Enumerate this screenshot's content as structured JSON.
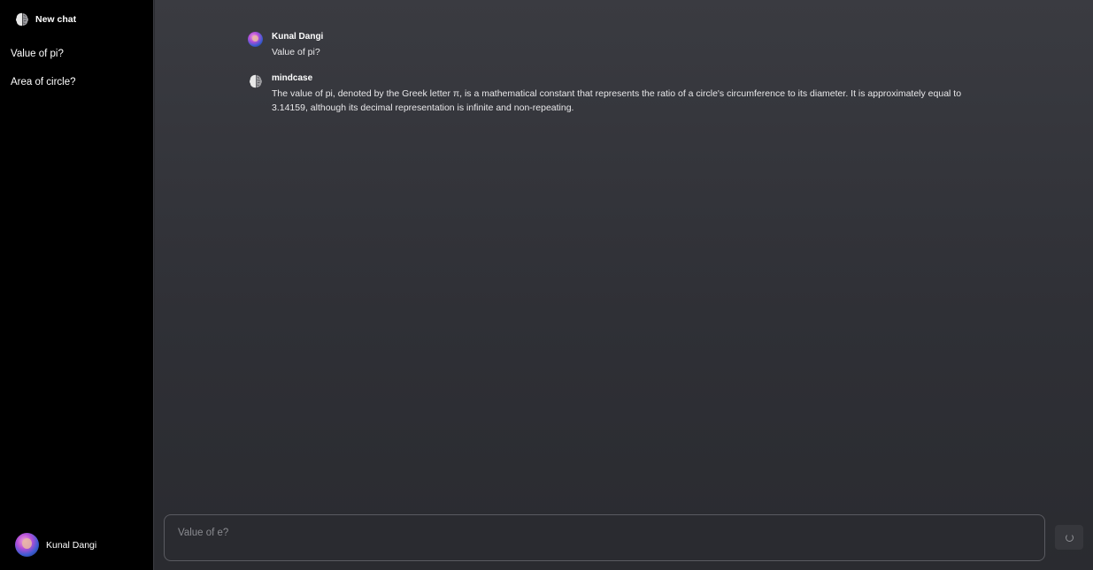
{
  "sidebar": {
    "new_chat_label": "New chat",
    "history": [
      {
        "label": "Value of pi?"
      },
      {
        "label": "Area of circle?"
      }
    ],
    "user_name": "Kunal Dangi"
  },
  "conversation": {
    "messages": [
      {
        "author": "Kunal Dangi",
        "text": "Value of pi?",
        "icon": "user-avatar"
      },
      {
        "author": "mindcase",
        "text": "The value of pi, denoted by the Greek letter π, is a mathematical constant that represents the ratio of a circle's circumference to its diameter. It is approximately equal to 3.14159, although its decimal representation is infinite and non-repeating.",
        "icon": "brain-icon"
      }
    ]
  },
  "composer": {
    "placeholder": "Value of e?",
    "send_icon": "loading-spinner-icon"
  },
  "colors": {
    "sidebar_bg": "#000000",
    "main_bg": "#2f3036",
    "text": "#ffffff"
  }
}
